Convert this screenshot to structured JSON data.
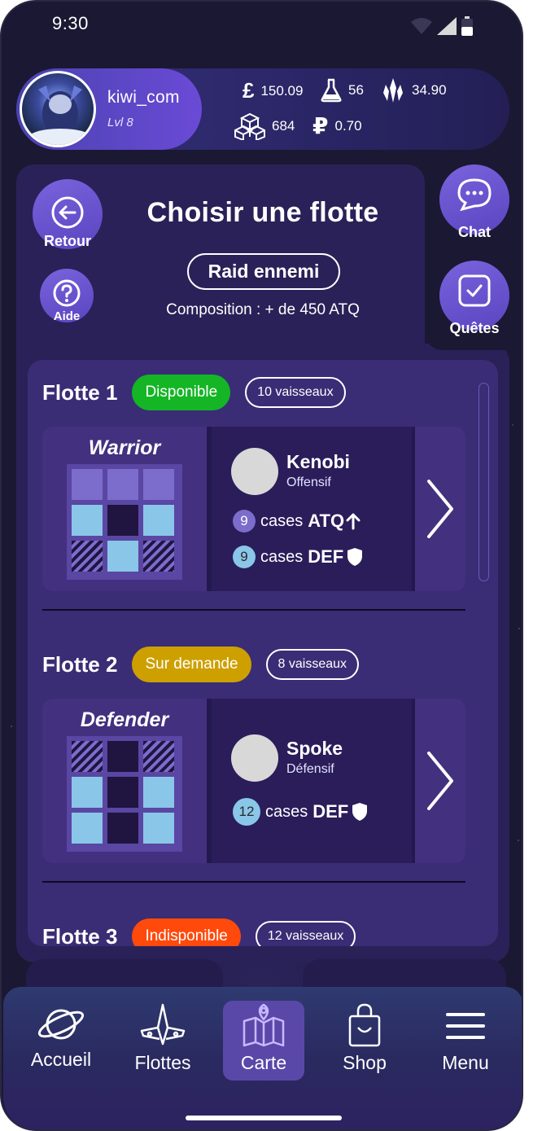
{
  "status": {
    "time": "9:30"
  },
  "profile": {
    "username": "kiwi_com",
    "level": "Lvl 8"
  },
  "resources": {
    "pounds": "150.09",
    "potion": "56",
    "crystals": "34.90",
    "blocks": "684",
    "rubles": "0.70"
  },
  "header": {
    "back_label": "Retour",
    "help_label": "Aide",
    "title": "Choisir une flotte",
    "mode": "Raid ennemi",
    "composition": "Composition : + de 450 ATQ"
  },
  "side": {
    "chat_label": "Chat",
    "quests_label": "Quêtes"
  },
  "fleets": [
    {
      "name": "Flotte 1",
      "status": "Disponible",
      "status_color": "#14b626",
      "ships": "10 vaisseaux",
      "class": "Warrior",
      "leader": "Kenobi",
      "role": "Offensif",
      "stats": [
        {
          "num": "9",
          "label": "cases",
          "type": "ATQ"
        },
        {
          "num": "9",
          "label": "cases",
          "type": "DEF"
        }
      ]
    },
    {
      "name": "Flotte 2",
      "status": "Sur demande",
      "status_color": "#cda000",
      "ships": "8 vaisseaux",
      "class": "Defender",
      "leader": "Spoke",
      "role": "Défensif",
      "stats": [
        {
          "num": "12",
          "label": "cases",
          "type": "DEF"
        }
      ]
    },
    {
      "name": "Flotte 3",
      "status": "Indisponible",
      "status_color": "#ff4a0c",
      "ships": "12 vaisseaux"
    }
  ],
  "nav": {
    "items": [
      {
        "label": "Accueil",
        "icon": "planet-icon"
      },
      {
        "label": "Flottes",
        "icon": "spaceship-icon"
      },
      {
        "label": "Carte",
        "icon": "map-icon",
        "active": true
      },
      {
        "label": "Shop",
        "icon": "shopping-bag-icon"
      },
      {
        "label": "Menu",
        "icon": "hamburger-icon"
      }
    ]
  }
}
